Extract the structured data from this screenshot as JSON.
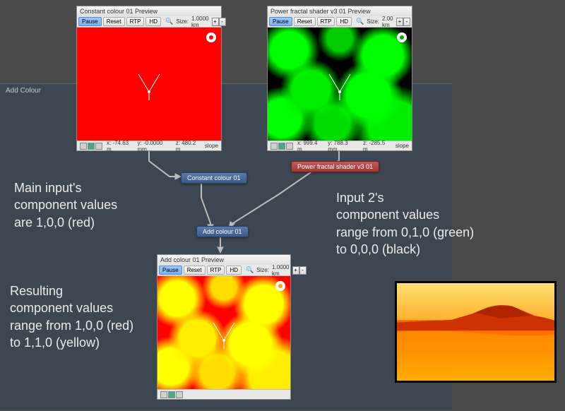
{
  "panel": {
    "title": "Add Colour"
  },
  "previews": {
    "constant": {
      "title": "Constant colour 01 Preview",
      "pause": "Pause",
      "reset": "Reset",
      "rtp": "RTP",
      "hd": "HD",
      "sizeLabel": "Size:",
      "size": "1.0000 km",
      "x": "x: -74.63 m",
      "y": "y: -0.0000 mm",
      "z": "z: 480.2 m",
      "slope": "slope"
    },
    "fractal": {
      "title": "Power fractal shader v3 01 Preview",
      "pause": "Pause",
      "reset": "Reset",
      "rtp": "RTP",
      "hd": "HD",
      "sizeLabel": "Size:",
      "size": "2.00 km",
      "x": "x: 999.4 m",
      "y": "y: 788.3 mm",
      "z": "z: -285.5 m",
      "slope": "slope"
    },
    "add": {
      "title": "Add colour 01 Preview",
      "pause": "Pause",
      "reset": "Reset",
      "rtp": "RTP",
      "hd": "HD",
      "sizeLabel": "Size:",
      "size": "1.0000 km"
    }
  },
  "nodes": {
    "constant": "Constant colour 01",
    "fractal": "Power fractal shader v3 01",
    "add": "Add colour 01"
  },
  "annotations": {
    "main": "Main input's\ncomponent values\nare 1,0,0 (red)",
    "input2": "Input 2's\ncomponent values\nrange from 0,1,0 (green)\nto 0,0,0 (black)",
    "result": "Resulting\ncomponent values\nrange from 1,0,0 (red)\nto 1,1,0 (yellow)"
  }
}
